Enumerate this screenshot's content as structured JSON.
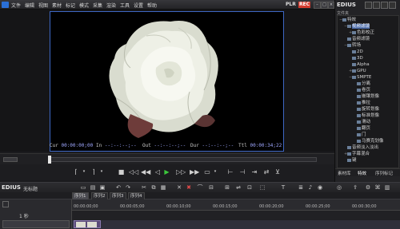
{
  "app": {
    "menus": [
      "文件",
      "编辑",
      "视图",
      "素材",
      "标记",
      "模式",
      "采集",
      "渲染",
      "工具",
      "设置",
      "帮助"
    ],
    "mode_left": "PLR",
    "mode_right": "REC"
  },
  "player": {
    "cur_label": "Cur",
    "cur_value": "00:00:00;00",
    "in_label": "In",
    "in_value": "--:--:--;--",
    "out_label": "Out",
    "out_value": "--:--:--;--",
    "dur_label": "Dur",
    "dur_value": "--:--:--;--",
    "ttl_label": "Ttl",
    "ttl_value": "00:00:34;22"
  },
  "right_panel": {
    "brand": "EDIUS",
    "panel_label": "文件夹",
    "tree": [
      {
        "label": "特效",
        "indent": 0,
        "expander": "−"
      },
      {
        "label": "视频滤镜",
        "indent": 1,
        "expander": "−",
        "selected": true
      },
      {
        "label": "色彩校正",
        "indent": 2,
        "expander": "+"
      },
      {
        "label": "音频滤镜",
        "indent": 1,
        "expander": ""
      },
      {
        "label": "转场",
        "indent": 1,
        "expander": "−"
      },
      {
        "label": "2D",
        "indent": 2,
        "expander": ""
      },
      {
        "label": "3D",
        "indent": 2,
        "expander": ""
      },
      {
        "label": "Alpha",
        "indent": 2,
        "expander": ""
      },
      {
        "label": "GPU",
        "indent": 2,
        "expander": "+"
      },
      {
        "label": "SMPTE",
        "indent": 2,
        "expander": "−"
      },
      {
        "label": "分离",
        "indent": 3,
        "expander": ""
      },
      {
        "label": "卷页",
        "indent": 3,
        "expander": ""
      },
      {
        "label": "嵌镶划像",
        "indent": 3,
        "expander": ""
      },
      {
        "label": "推拉",
        "indent": 3,
        "expander": ""
      },
      {
        "label": "旋转划像",
        "indent": 3,
        "expander": ""
      },
      {
        "label": "标准划像",
        "indent": 3,
        "expander": ""
      },
      {
        "label": "滑动",
        "indent": 3,
        "expander": ""
      },
      {
        "label": "翻页",
        "indent": 3,
        "expander": ""
      },
      {
        "label": "门",
        "indent": 3,
        "expander": ""
      },
      {
        "label": "马赛克划像",
        "indent": 3,
        "expander": ""
      },
      {
        "label": "音频淡入淡出",
        "indent": 1,
        "expander": ""
      },
      {
        "label": "字幕混合",
        "indent": 1,
        "expander": "+"
      },
      {
        "label": "键",
        "indent": 1,
        "expander": ""
      }
    ],
    "tabs": [
      "素材库",
      "特效",
      "序列标记"
    ]
  },
  "timeline": {
    "brand": "EDIUS",
    "project_name": "无标题",
    "sequence_tabs": [
      "序列1",
      "序列2",
      "序列3",
      "序列4"
    ],
    "track_label": "1 秒",
    "ruler_ticks": [
      "00:00:00;00",
      "00:00:05;00",
      "00:00:10;00",
      "00:00:15;00",
      "00:00:20;00",
      "00:00:25;00",
      "00:00:30;00"
    ]
  },
  "colors": {
    "accent_blue": "#3d67c4",
    "rec_red": "#d23a2e",
    "selection": "#4a6aa8",
    "play_green": "#3cc83c"
  }
}
